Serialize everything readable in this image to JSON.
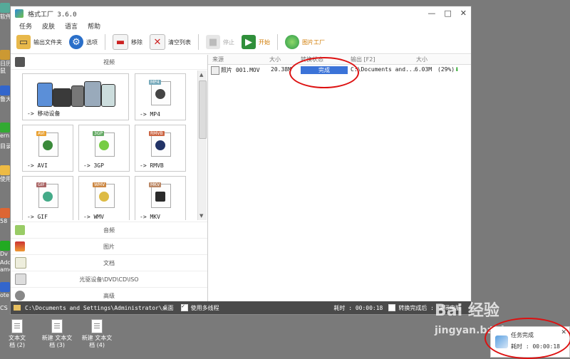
{
  "desktop_left_labels": [
    "软件",
    "日历",
    "鼠",
    "鲁大",
    "ern",
    "目录",
    "使用",
    "58",
    "Dv",
    "Ado",
    "ame",
    "ote",
    "CS"
  ],
  "desktop_files": [
    {
      "top": "文本文",
      "bottom": "档 (2)"
    },
    {
      "top": "新建 文本文",
      "bottom": "档 (3)"
    },
    {
      "top": "新建 文本文",
      "bottom": "档 (4)"
    }
  ],
  "window": {
    "title": "格式工厂 3.6.0",
    "min": "—",
    "max": "□",
    "close": "✕"
  },
  "menu": [
    "任务",
    "皮肤",
    "语言",
    "帮助"
  ],
  "toolbar": {
    "output_folder": "输出文件夹",
    "options": "选项",
    "remove": "移除",
    "clear_list": "清空列表",
    "stop": "停止",
    "start": "开始",
    "factory": "图片工厂"
  },
  "categories": {
    "video": "视频",
    "audio": "音频",
    "picture": "图片",
    "document": "文档",
    "optical": "光驱设备\\DVD\\CD\\ISO",
    "advanced": "高级"
  },
  "tiles": [
    {
      "label": "-> 移动设备"
    },
    {
      "label": "-> MP4",
      "tag": "MP4"
    },
    {
      "label": "-> AVI",
      "tag": "AVI"
    },
    {
      "label": "-> 3GP",
      "tag": "3GP"
    },
    {
      "label": "-> RMVB",
      "tag": "RMVB"
    },
    {
      "label": "-> GIF",
      "tag": "GIF"
    },
    {
      "label": "-> WMV",
      "tag": "WMV"
    },
    {
      "label": "-> MKV",
      "tag": "MKV"
    }
  ],
  "table": {
    "headers": [
      "来源",
      "大小",
      "转换状态",
      "输出 [F2]",
      "大小"
    ],
    "rows": [
      {
        "source": "照片 001.MOV",
        "size": "20.38M",
        "status": "完成",
        "output": "C:\\Documents and...",
        "out_size": "6.03M",
        "ratio": "(29%)"
      }
    ]
  },
  "statusbar": {
    "path": "C:\\Documents and Settings\\Administrator\\桌面",
    "multithread": "使用多线程",
    "elapsed": "耗时 : 00:00:18",
    "after_convert": "转换完成后 :",
    "after_action": "关闭电脑"
  },
  "popup": {
    "title": "任务完成",
    "time": "耗时 : 00:00:18",
    "close": "✕"
  },
  "watermark": {
    "line1": "Bai 经验",
    "line2": "jingyan.baidu.com"
  }
}
